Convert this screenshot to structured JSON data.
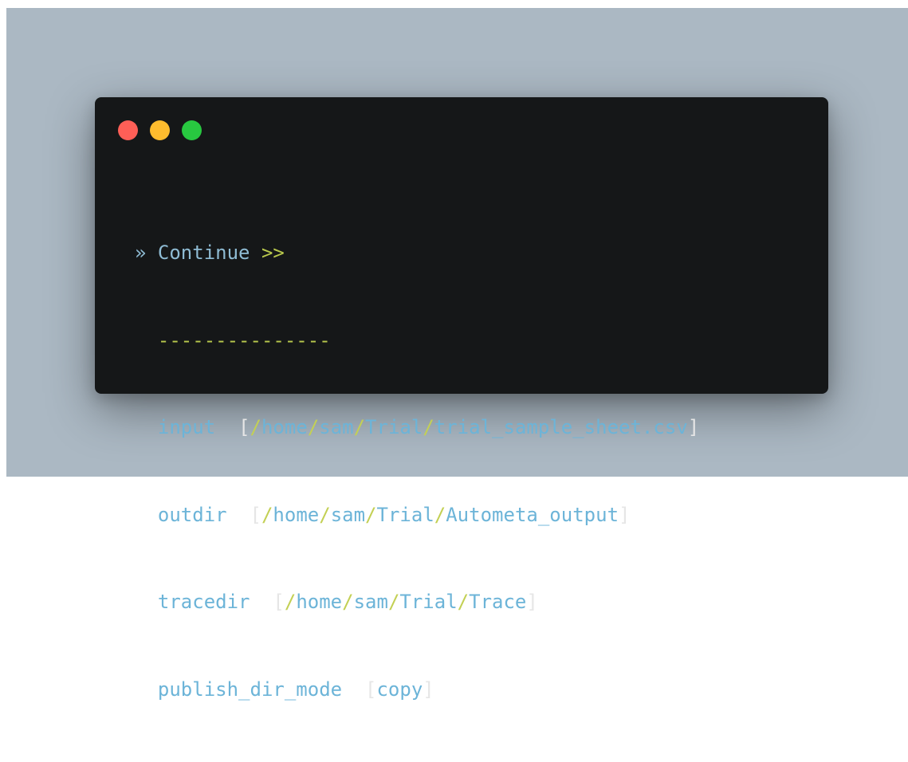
{
  "window": {
    "controls": {
      "close_color": "#ff5f57",
      "minimize_color": "#febc2e",
      "maximize_color": "#28c840"
    }
  },
  "terminal": {
    "prompt_symbol": "»",
    "command": "Continue",
    "command_suffix": ">>",
    "divider": "---------------",
    "params": [
      {
        "key": "input",
        "value": "[/home/sam/Trial/trial_sample_sheet.csv]"
      },
      {
        "key": "outdir",
        "value": "[/home/sam/Trial/Autometa_output]"
      },
      {
        "key": "tracedir",
        "value": "[/home/sam/Trial/Trace]"
      },
      {
        "key": "publish_dir_mode",
        "value": "[copy]"
      }
    ]
  }
}
